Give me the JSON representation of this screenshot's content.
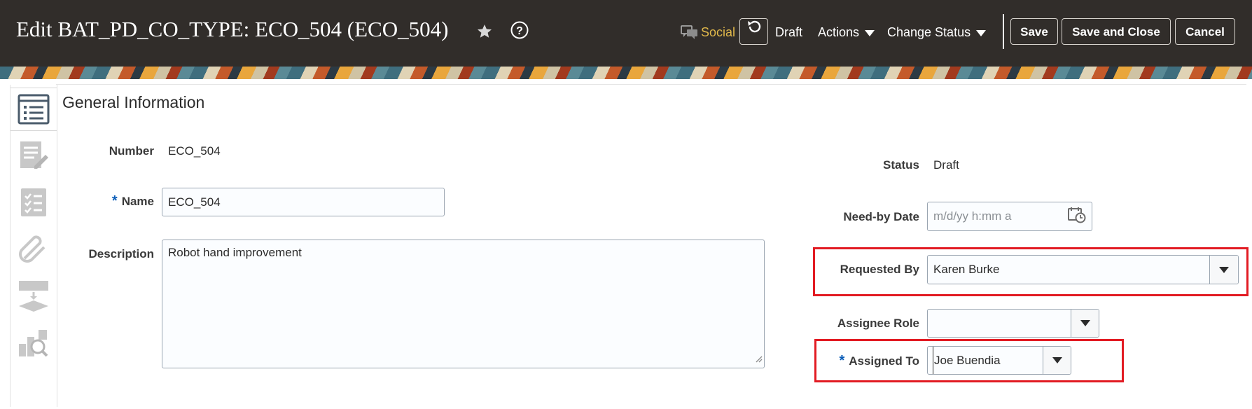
{
  "header": {
    "title": "Edit BAT_PD_CO_TYPE: ECO_504 (ECO_504)",
    "favorite_icon": "star-icon",
    "help_icon": "help-circle-icon",
    "social_label": "Social",
    "status_label": "Draft",
    "actions_label": "Actions",
    "change_status_label": "Change Status",
    "save_label": "Save",
    "save_close_label": "Save and Close",
    "cancel_label": "Cancel",
    "colors": {
      "bar": "#312d2a",
      "social": "#e0b84a"
    }
  },
  "sidenav": {
    "items": [
      {
        "icon": "general-information-icon",
        "active": true
      },
      {
        "icon": "edit-document-icon",
        "active": false
      },
      {
        "icon": "checklist-icon",
        "active": false
      },
      {
        "icon": "attachment-icon",
        "active": false
      },
      {
        "icon": "workflow-icon",
        "active": false
      },
      {
        "icon": "search-analysis-icon",
        "active": false
      }
    ]
  },
  "section": {
    "title": "General Information"
  },
  "form": {
    "number_label": "Number",
    "number_value": "ECO_504",
    "name_label": "Name",
    "name_value": "ECO_504",
    "description_label": "Description",
    "description_value": "Robot hand improvement",
    "status_label": "Status",
    "status_value": "Draft",
    "need_by_label": "Need-by Date",
    "need_by_placeholder": "m/d/yy h:mm a",
    "requested_by_label": "Requested By",
    "requested_by_value": "Karen Burke",
    "assignee_role_label": "Assignee Role",
    "assignee_role_value": "",
    "assigned_to_label": "Assigned To",
    "assigned_to_value": "Joe Buendia",
    "required_marker": "*"
  }
}
